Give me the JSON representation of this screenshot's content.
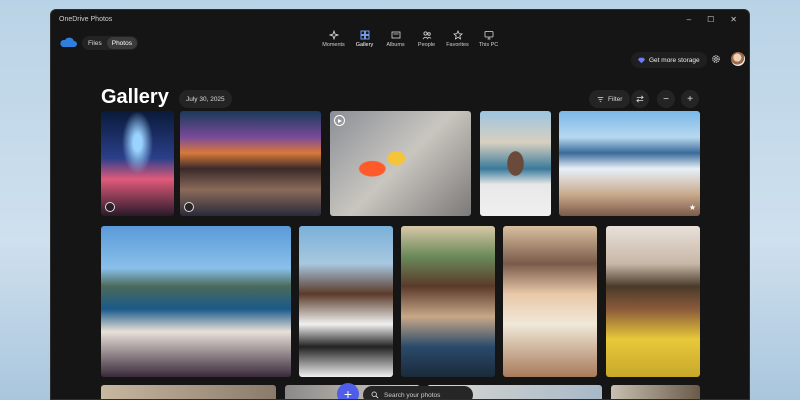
{
  "window": {
    "title": "OneDrive Photos",
    "controls": {
      "minimize": "–",
      "maximize": "☐",
      "close": "✕"
    }
  },
  "segmented": {
    "items": [
      {
        "label": "Files",
        "active": false
      },
      {
        "label": "Photos",
        "active": true
      }
    ]
  },
  "nav": {
    "items": [
      {
        "label": "Moments",
        "icon": "sparkle-icon"
      },
      {
        "label": "Gallery",
        "icon": "gallery-icon",
        "active": true
      },
      {
        "label": "Albums",
        "icon": "album-icon"
      },
      {
        "label": "People",
        "icon": "people-icon"
      },
      {
        "label": "Favorites",
        "icon": "star-icon"
      },
      {
        "label": "This PC",
        "icon": "monitor-icon"
      }
    ]
  },
  "storage": {
    "label": "Get more storage",
    "icon": "diamond-icon"
  },
  "header": {
    "title": "Gallery",
    "date": "July 30, 2025",
    "filter_label": "Filter",
    "filter_icon": "filter-icon"
  },
  "actions": {
    "sort_icon": "arrows-icon",
    "zoom_out": "−",
    "zoom_in": "+"
  },
  "search": {
    "placeholder": "Search your photos",
    "add": "+"
  },
  "colors": {
    "accent": "#4f5ee8",
    "window_bg": "#151515",
    "desktop": "#b9d3e6"
  }
}
